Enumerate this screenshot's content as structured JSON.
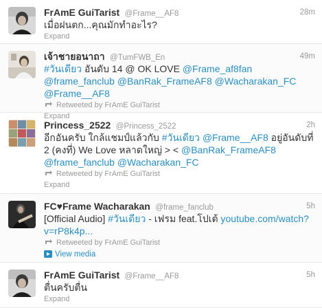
{
  "colors": {
    "link": "#2a8ec2",
    "meta_gray": "#999999",
    "text": "#333333",
    "divider": "#e8e8e8"
  },
  "tweets": [
    {
      "fullname": "FrAmE GuiTarist",
      "username": "@Frame__AF8",
      "time": "28m",
      "text": "เมื่อฝนตก...คุณมักทำอะไร?",
      "expand": "Expand",
      "avatar_icon": "guitarist-photo"
    },
    {
      "fullname": "เจ้าชายอนาถา",
      "username": "@TumFWB_En",
      "time": "49m",
      "text_parts": [
        "#วันเดียว",
        " อันดับ 14 @ OK LOVE ",
        "@Frame_af8fan",
        " ",
        "@frame_fanclub",
        " ",
        "@BanRak_FrameAF8",
        " ",
        "@Wacharakan_FC",
        " ",
        "@Frame__AF8"
      ],
      "retweeted_by": "Retweeted by FrAmE GuiTarist",
      "expand": "Expand",
      "avatar_icon": "fan-photo"
    },
    {
      "fullname": "Princess_2522",
      "username": "@Princess_2522",
      "time": "2h",
      "text_parts": [
        "อีกอันครับ ใกล้แชมป์แล้วกับ ",
        "#วันเดียว",
        " ",
        "@Frame__AF8",
        " อยู่อันดับที่ 2 (คงที่) We Love หลาดใหญ่ > < ",
        "@BanRak_FrameAF8",
        " ",
        "@frame_fanclub",
        " ",
        "@Wacharakan_FC"
      ],
      "retweeted_by": "Retweeted by FrAmE GuiTarist",
      "expand": "Expand",
      "avatar_icon": "collage-photo"
    },
    {
      "fullname": "FC♥Frame Wacharakan",
      "username": "@frame_fanclub",
      "time": "5h",
      "text_parts": [
        "[Official Audio] ",
        "#วันเดียว",
        " - เฟรม feat.โปเต้ ",
        "youtube.com/watch?v=rP8k4p..."
      ],
      "retweeted_by": "Retweeted by FrAmE GuiTarist",
      "view_media": "View media",
      "avatar_icon": "guitar-player-photo"
    },
    {
      "fullname": "FrAmE GuiTarist",
      "username": "@Frame__AF8",
      "time": "5h",
      "text": "ตื่นครับตื่น",
      "expand": "Expand",
      "avatar_icon": "guitarist-photo"
    }
  ]
}
